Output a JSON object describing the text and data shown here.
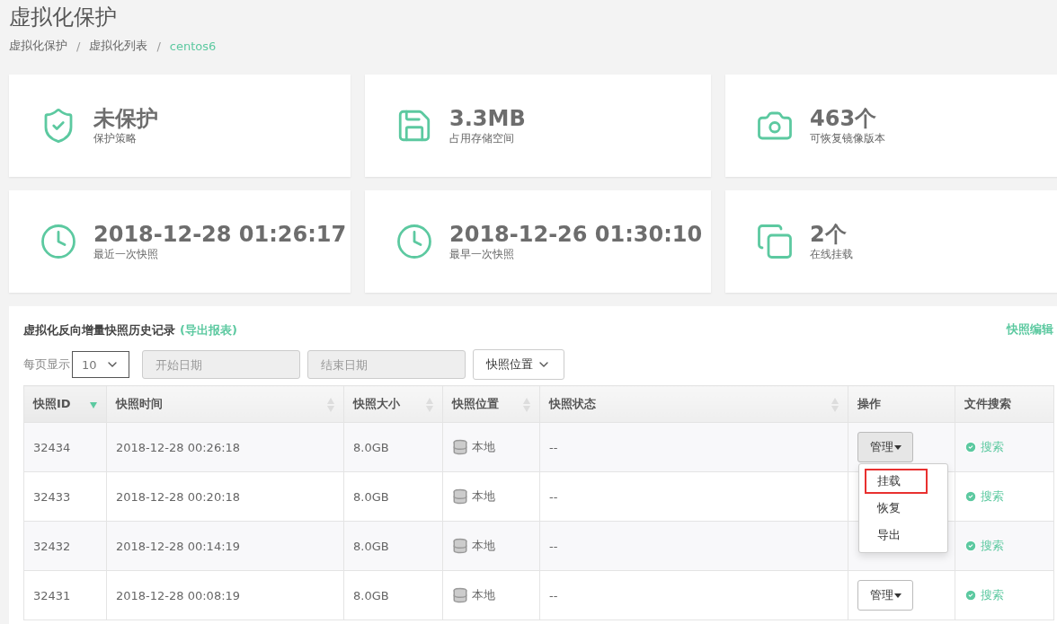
{
  "page_title": "虚拟化保护",
  "breadcrumb_separator": "/",
  "breadcrumb": [
    {
      "label": "虚拟化保护",
      "current": false
    },
    {
      "label": "虚拟化列表",
      "current": false
    },
    {
      "label": "centos6",
      "current": true
    }
  ],
  "stats": [
    {
      "value": "未保护",
      "label": "保护策略"
    },
    {
      "value": "3.3MB",
      "label": "占用存储空间"
    },
    {
      "value": "463个",
      "label": "可恢复镜像版本"
    },
    {
      "value": "2018-12-28 01:26:17",
      "label": "最近一次快照"
    },
    {
      "value": "2018-12-26 01:30:10",
      "label": "最早一次快照"
    },
    {
      "value": "2个",
      "label": "在线挂载"
    }
  ],
  "history": {
    "title": "虚拟化反向增量快照历史记录",
    "export_link": "(导出报表)",
    "edit_link": "快照编辑",
    "page_size_label": "每页显示",
    "page_size": "10",
    "start_date": {
      "placeholder": "开始日期"
    },
    "end_date": {
      "placeholder": "结束日期"
    },
    "location_filter": "快照位置",
    "columns": [
      {
        "label": "快照ID",
        "sortable": true,
        "sorted": true
      },
      {
        "label": "快照时间",
        "sortable": true,
        "sorted": false
      },
      {
        "label": "快照大小",
        "sortable": true,
        "sorted": false
      },
      {
        "label": "快照位置",
        "sortable": true,
        "sorted": false
      },
      {
        "label": "快照状态",
        "sortable": true,
        "sorted": false
      },
      {
        "label": "操作"
      },
      {
        "label": "文件搜索"
      }
    ],
    "rows": [
      {
        "id": "32434",
        "time": "2018-12-28 00:26:18",
        "size": "8.0GB",
        "location": "本地",
        "status": "--",
        "action": "管理",
        "action_pressed": true,
        "search": "搜索"
      },
      {
        "id": "32433",
        "time": "2018-12-28 00:20:18",
        "size": "8.0GB",
        "location": "本地",
        "status": "--",
        "search": "搜索"
      },
      {
        "id": "32432",
        "time": "2018-12-28 00:14:19",
        "size": "8.0GB",
        "location": "本地",
        "status": "--",
        "search": "搜索"
      },
      {
        "id": "32431",
        "time": "2018-12-28 00:08:19",
        "size": "8.0GB",
        "location": "本地",
        "status": "--",
        "action": "管理",
        "action_pressed": false,
        "search": "搜索"
      }
    ],
    "action_menu": [
      {
        "label": "挂载",
        "selected": true
      },
      {
        "label": "恢复",
        "selected": false
      },
      {
        "label": "导出",
        "selected": false
      }
    ]
  }
}
